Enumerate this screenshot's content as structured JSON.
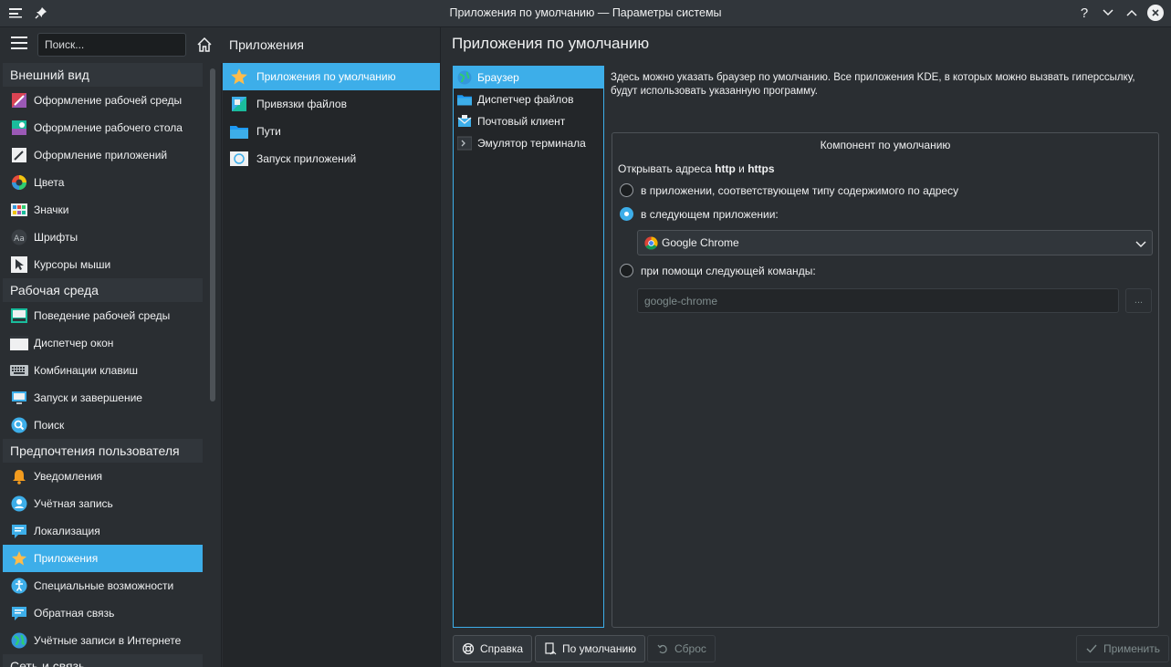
{
  "window": {
    "title": "Приложения по умолчанию — Параметры системы",
    "help_glyph": "?"
  },
  "sidebar": {
    "search_placeholder": "Поиск...",
    "categories": [
      {
        "label": "Внешний вид",
        "items": [
          {
            "label": "Оформление рабочей среды",
            "icon": "workspace-theme-icon"
          },
          {
            "label": "Оформление рабочего стола",
            "icon": "desktop-theme-icon"
          },
          {
            "label": "Оформление приложений",
            "icon": "app-style-icon"
          },
          {
            "label": "Цвета",
            "icon": "colors-icon"
          },
          {
            "label": "Значки",
            "icon": "icons-icon"
          },
          {
            "label": "Шрифты",
            "icon": "fonts-icon"
          },
          {
            "label": "Курсоры мыши",
            "icon": "cursor-icon"
          }
        ]
      },
      {
        "label": "Рабочая среда",
        "items": [
          {
            "label": "Поведение рабочей среды",
            "icon": "workspace-behavior-icon"
          },
          {
            "label": "Диспетчер окон",
            "icon": "window-manager-icon"
          },
          {
            "label": "Комбинации клавиш",
            "icon": "keyboard-icon"
          },
          {
            "label": "Запуск и завершение",
            "icon": "startup-icon"
          },
          {
            "label": "Поиск",
            "icon": "search-icon"
          }
        ]
      },
      {
        "label": "Предпочтения пользователя",
        "items": [
          {
            "label": "Уведомления",
            "icon": "bell-icon"
          },
          {
            "label": "Учётная запись",
            "icon": "user-icon"
          },
          {
            "label": "Локализация",
            "icon": "locale-icon"
          },
          {
            "label": "Приложения",
            "icon": "star-icon",
            "active": true
          },
          {
            "label": "Специальные возможности",
            "icon": "accessibility-icon"
          },
          {
            "label": "Обратная связь",
            "icon": "feedback-icon"
          },
          {
            "label": "Учётные записи в Интернете",
            "icon": "globe-icon"
          }
        ]
      },
      {
        "label": "Сеть и связь",
        "items": []
      }
    ]
  },
  "middle": {
    "heading": "Приложения",
    "items": [
      {
        "label": "Приложения по умолчанию",
        "icon": "star-icon",
        "active": true
      },
      {
        "label": "Привязки файлов",
        "icon": "file-assoc-icon"
      },
      {
        "label": "Пути",
        "icon": "folder-icon"
      },
      {
        "label": "Запуск приложений",
        "icon": "launch-feedback-icon"
      }
    ]
  },
  "main": {
    "title": "Приложения по умолчанию",
    "components": [
      {
        "label": "Браузер",
        "icon": "browser-icon",
        "active": true
      },
      {
        "label": "Диспетчер файлов",
        "icon": "folder-icon"
      },
      {
        "label": "Почтовый клиент",
        "icon": "mail-icon"
      },
      {
        "label": "Эмулятор терминала",
        "icon": "terminal-icon"
      }
    ],
    "description": "Здесь можно указать браузер по умолчанию. Все приложения KDE, в которых можно вызвать гиперссылку, будут использовать указанную программу.",
    "group_title": "Компонент по умолчанию",
    "open_prefix": "Открывать адреса ",
    "open_http": "http",
    "open_and": " и ",
    "open_https": "https",
    "radio_by_content": "в приложении, соответствующем типу содержимого по адресу",
    "radio_following_app": "в следующем приложении:",
    "selected_app": "Google Chrome",
    "radio_command": "при помощи следующей команды:",
    "command_value": "google-chrome",
    "browse_label": "...",
    "selected_option": "radio_following_app"
  },
  "buttons": {
    "help": "Справка",
    "defaults": "По умолчанию",
    "reset": "Сброс",
    "apply": "Применить"
  },
  "colors": {
    "accent": "#3daee9",
    "background": "#2a2e32",
    "panel": "#232629"
  }
}
